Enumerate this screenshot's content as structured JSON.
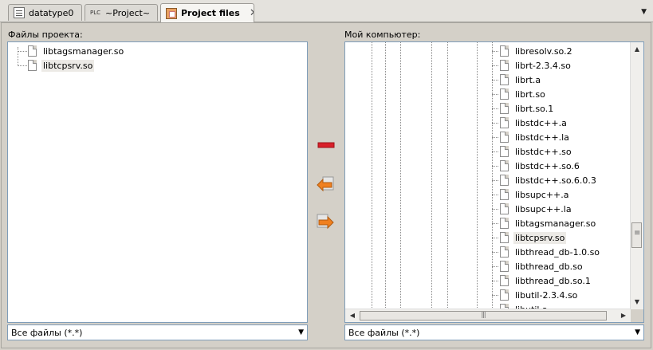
{
  "tabs": [
    {
      "label": "datatype0",
      "icon": "document-icon",
      "active": false
    },
    {
      "label": "~Project~",
      "icon": "plc-icon",
      "active": false
    },
    {
      "label": "Project files",
      "icon": "project-files-icon",
      "active": true
    }
  ],
  "tab_close_glyph": "✕",
  "tabs_menu_glyph": "▼",
  "left_panel": {
    "label": "Файлы проекта:",
    "files": [
      "libtagsmanager.so",
      "libtcpsrv.so"
    ],
    "selected_index": 1,
    "filter": "Все файлы (*.*)"
  },
  "right_panel": {
    "label": "Мой компьютер:",
    "files": [
      "libresolv.so.2",
      "librt-2.3.4.so",
      "librt.a",
      "librt.so",
      "librt.so.1",
      "libstdc++.a",
      "libstdc++.la",
      "libstdc++.so",
      "libstdc++.so.6",
      "libstdc++.so.6.0.3",
      "libsupc++.a",
      "libsupc++.la",
      "libtagsmanager.so",
      "libtcpsrv.so",
      "libthread_db-1.0.so",
      "libthread_db.so",
      "libthread_db.so.1",
      "libutil-2.3.4.so",
      "libutil.a"
    ],
    "selected_index": 13,
    "filter": "Все файлы (*.*)"
  },
  "actions": [
    {
      "name": "remove-from-project",
      "icon": "minus-icon"
    },
    {
      "name": "add-to-project",
      "icon": "arrow-left-icon"
    },
    {
      "name": "export-to-computer",
      "icon": "arrow-right-icon"
    }
  ],
  "combo_arrow_glyph": "▼",
  "colors": {
    "accent_red": "#d8202a",
    "arrow_orange": "#f08020"
  }
}
